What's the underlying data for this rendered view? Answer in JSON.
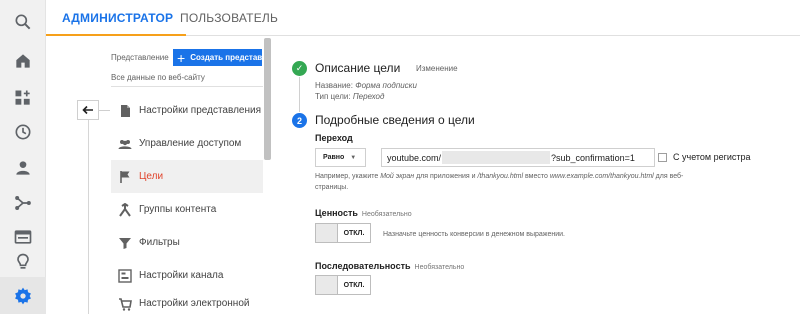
{
  "tabs": {
    "admin": "АДМИНИСТРАТОР",
    "user": "ПОЛЬЗОВАТЕЛЬ"
  },
  "rail": {
    "icons": [
      "search-icon",
      "home-icon",
      "customization-icon",
      "clock-icon",
      "person-icon",
      "acquisition-icon",
      "behavior-icon",
      "lightbulb-icon",
      "gear-icon"
    ]
  },
  "view": {
    "label": "Представление",
    "create_button": "Создать представл",
    "all_data": "Все данные по веб-сайту"
  },
  "menu": {
    "items": [
      {
        "label": "Настройки представления",
        "icon": "document-icon"
      },
      {
        "label": "Управление доступом",
        "icon": "people-icon"
      },
      {
        "label": "Цели",
        "icon": "flag-icon"
      },
      {
        "label": "Группы контента",
        "icon": "content-group-icon"
      },
      {
        "label": "Фильтры",
        "icon": "filter-icon"
      },
      {
        "label": "Настройки канала",
        "icon": "channel-icon"
      },
      {
        "label": "Настройки электронной",
        "icon": "cart-icon"
      }
    ],
    "active_index": 2
  },
  "goal": {
    "step1": {
      "number": "✓",
      "title": "Описание цели",
      "edit": "Изменение",
      "name_label": "Название:",
      "name_value": "Форма подписки",
      "type_label": "Тип цели:",
      "type_value": "Переход"
    },
    "step2": {
      "number": "2",
      "title": "Подробные сведения о цели",
      "destination_label": "Переход",
      "match_type": "Равно",
      "url_prefix": "youtube.com/",
      "url_suffix": "?sub_confirmation=1",
      "case_sensitive_label": "С учетом регистра",
      "hint_line1_a": "Например, укажите ",
      "hint_line1_b": "Мой экран",
      "hint_line1_c": " для приложения и ",
      "hint_line1_d": "/thankyou.html",
      "hint_line1_e": " вместо ",
      "hint_line1_f": "www.example.com/thankyou.html",
      "hint_line1_g": " для веб-",
      "hint_line2": "страницы.",
      "value_label": "Ценность",
      "value_optional": "Необязательно",
      "value_toggle": "ОТКЛ.",
      "value_desc": "Назначьте ценность конверсии в денежном выражении.",
      "funnel_label": "Последовательность",
      "funnel_optional": "Необязательно",
      "funnel_toggle": "ОТКЛ."
    }
  },
  "colors": {
    "accent_blue": "#1a73e8",
    "tab_underline": "#f6a01a",
    "active_red": "#e0442c",
    "success_green": "#34a853"
  }
}
